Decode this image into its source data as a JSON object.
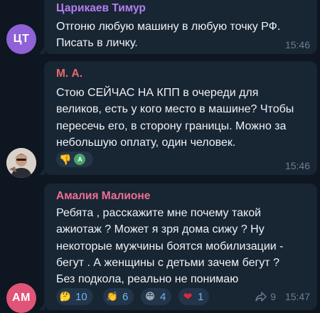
{
  "messages": [
    {
      "sender": "Царикаев Тимур",
      "sender_color": "#b57ff0",
      "avatar_initials": "ЦТ",
      "avatar_color": "#8f62d8",
      "lines": [
        "Отгоню любую машину в любую точку РФ.",
        "Писать в личку."
      ],
      "time": "15:46"
    },
    {
      "sender": "М. А.",
      "sender_color": "#e86a6a",
      "avatar_icon": "user-photo-avatar",
      "lines": [
        "Стою СЕЙЧАС НА КПП в очереди для",
        "великов, есть у кого место в машине? Чтобы",
        "пересечь его, в сторону границы. Можно за",
        "небольшую оплату, один человек."
      ],
      "reactions": [
        {
          "icon": "thumbs-down-icon",
          "glyph": "👎"
        },
        {
          "icon": "reactor-avatar",
          "initial": "A"
        }
      ],
      "time": "15:46"
    },
    {
      "sender": "Амалия Малионе",
      "sender_color": "#ee6f93",
      "avatar_initials": "AM",
      "avatar_color": "#e05477",
      "lines": [
        "Ребята , расскажите мне почему такой",
        "ажиотаж ? Может я зря дома сижу ? Ну",
        "некоторые мужчины боятся мобилизации -",
        "бегут . А женщины с детьми зачем бегут ?",
        "Без подкола, реально не понимаю"
      ],
      "reactions": [
        {
          "icon": "thinking-face-icon",
          "glyph": "🤔",
          "count": "10"
        },
        {
          "icon": "clapping-hands-icon",
          "glyph": "👏",
          "count": "6"
        },
        {
          "icon": "grinning-face-icon",
          "glyph": "😁",
          "count": "4"
        },
        {
          "icon": "red-heart-icon",
          "glyph": "❤",
          "count": "1"
        }
      ],
      "forwards": "9",
      "time": "15:47"
    }
  ],
  "colors": {
    "background": "#0e1621",
    "bubble": "#182533",
    "reaction_bg": "#233549",
    "reaction_count": "#6fb4ef",
    "meta": "#6c7f92"
  }
}
